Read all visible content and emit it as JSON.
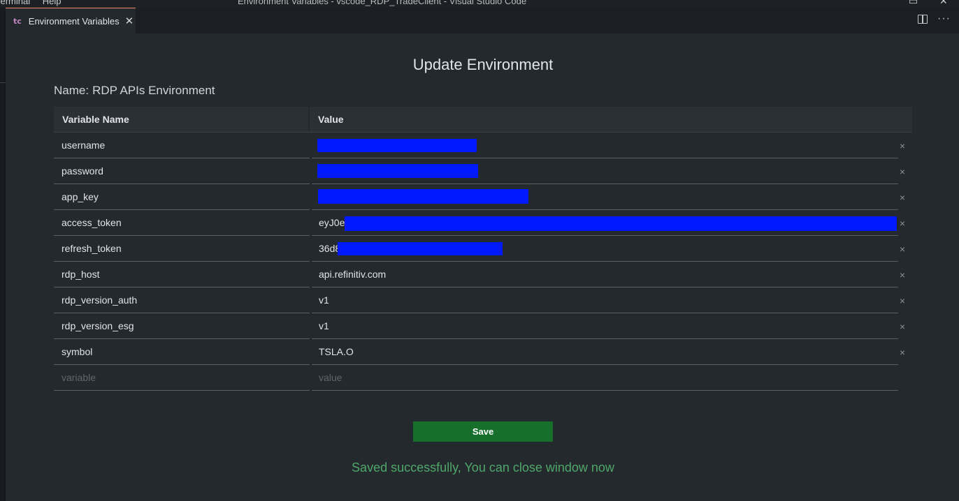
{
  "titlebar": {
    "menu": [
      "Terminal",
      "Help"
    ],
    "window_title": "Environment Variables - vscode_RDP_TradeClient - Visual Studio Code"
  },
  "tab": {
    "icon_text": "tc",
    "label": "Environment Variables",
    "close_glyph": "✕"
  },
  "tab_actions": {
    "more_glyph": "···"
  },
  "page": {
    "heading": "Update Environment",
    "name_label": "Name:",
    "name_value": "RDP APIs Environment"
  },
  "table": {
    "headers": {
      "name": "Variable Name",
      "value": "Value"
    },
    "rows": [
      {
        "name": "username",
        "value": ""
      },
      {
        "name": "password",
        "value": ""
      },
      {
        "name": "app_key",
        "value": ""
      },
      {
        "name": "access_token",
        "value": "eyJ0eX"
      },
      {
        "name": "refresh_token",
        "value": "36d8"
      },
      {
        "name": "rdp_host",
        "value": "api.refinitiv.com"
      },
      {
        "name": "rdp_version_auth",
        "value": "v1"
      },
      {
        "name": "rdp_version_esg",
        "value": "v1"
      },
      {
        "name": "symbol",
        "value": "TSLA.O"
      }
    ],
    "new_row": {
      "name_placeholder": "variable",
      "value_placeholder": "value"
    },
    "delete_glyph": "×"
  },
  "save_label": "Save",
  "status_message": "Saved successfully, You can close window now",
  "colors": {
    "accent": "#f9826c",
    "save_button": "#176f2c",
    "status_text": "#4fa86a",
    "redaction": "#0019ff"
  }
}
